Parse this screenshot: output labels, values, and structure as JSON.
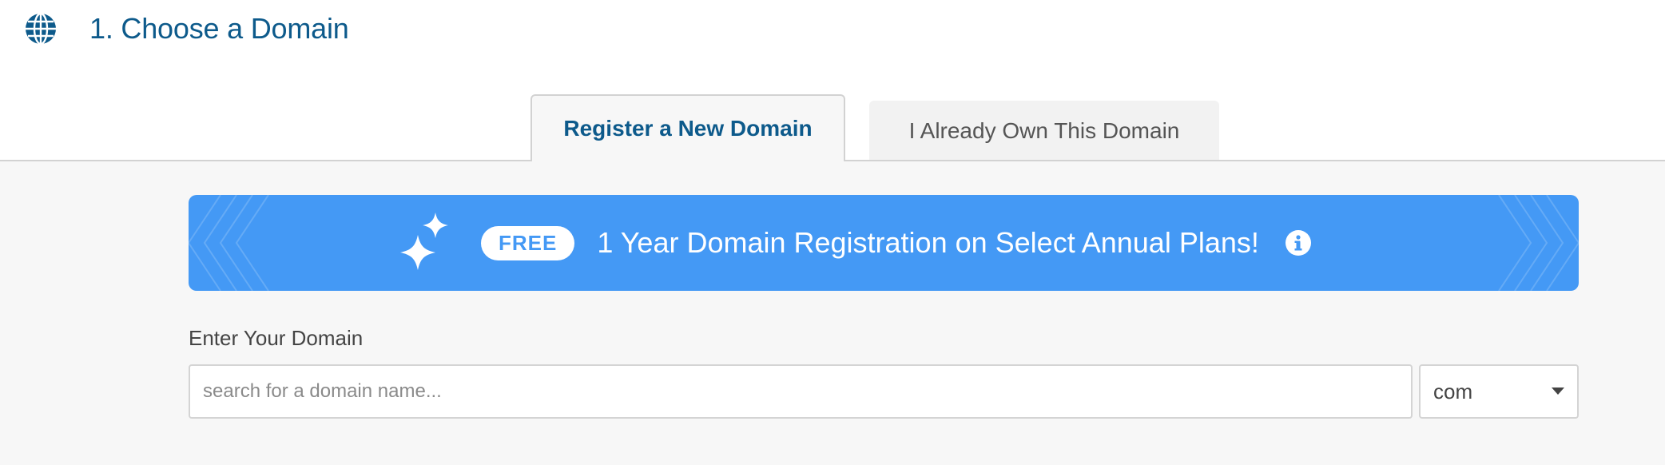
{
  "header": {
    "title": "1. Choose a Domain",
    "icon": "globe-icon"
  },
  "tabs": [
    {
      "label": "Register a New Domain",
      "active": true
    },
    {
      "label": "I Already Own This Domain",
      "active": false
    }
  ],
  "promo": {
    "badge": "FREE",
    "text": "1 Year Domain Registration on Select Annual Plans!",
    "icons": [
      "sparkle-icon",
      "info-icon"
    ],
    "background_color": "#4499f5"
  },
  "domain_search": {
    "label": "Enter Your Domain",
    "placeholder": "search for a domain name...",
    "value": "",
    "tld_selected": "com"
  },
  "colors": {
    "title": "#0d5a8b",
    "promo": "#4499f5",
    "content_bg": "#f7f7f7"
  }
}
